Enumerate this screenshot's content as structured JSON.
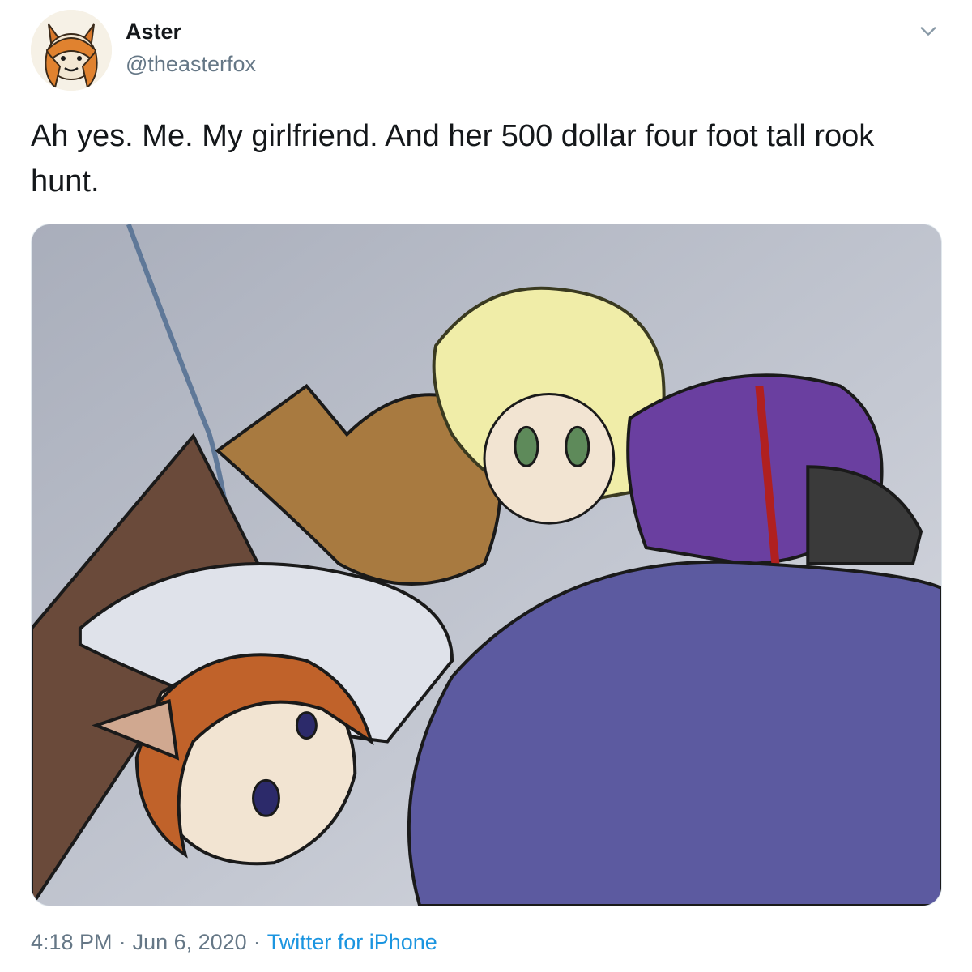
{
  "author": {
    "display_name": "Aster",
    "handle": "@theasterfox",
    "avatar_icon": "fox-avatar-icon"
  },
  "tweet": {
    "text": "Ah yes. Me. My girlfriend. And her 500 dollar four foot tall rook hunt."
  },
  "meta": {
    "time": "4:18 PM",
    "separator": "·",
    "date": "Jun 6, 2020",
    "source": "Twitter for iPhone"
  },
  "colors": {
    "text_primary": "#14171a",
    "text_secondary": "#657786",
    "link": "#1b95e0"
  },
  "icons": {
    "more_menu": "chevron-down-icon"
  }
}
